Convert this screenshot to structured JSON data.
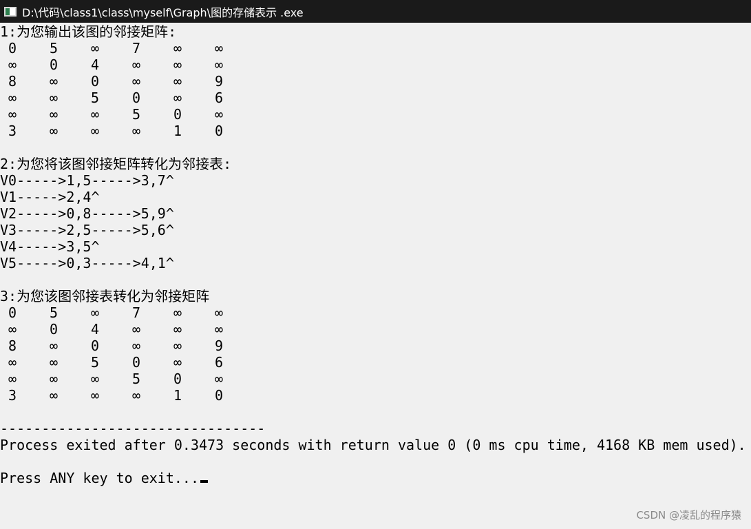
{
  "window": {
    "title": "D:\\代码\\class1\\class\\myself\\Graph\\图的存储表示 .exe"
  },
  "console": {
    "section1_header": "1:为您输出该图的邻接矩阵:",
    "matrix1": [
      [
        "0",
        "5",
        "∞",
        "7",
        "∞",
        "∞"
      ],
      [
        "∞",
        "0",
        "4",
        "∞",
        "∞",
        "∞"
      ],
      [
        "8",
        "∞",
        "0",
        "∞",
        "∞",
        "9"
      ],
      [
        "∞",
        "∞",
        "5",
        "0",
        "∞",
        "6"
      ],
      [
        "∞",
        "∞",
        "∞",
        "5",
        "0",
        "∞"
      ],
      [
        "3",
        "∞",
        "∞",
        "∞",
        "1",
        "0"
      ]
    ],
    "section2_header": "2:为您将该图邻接矩阵转化为邻接表:",
    "adjacency_list": [
      "V0----->1,5----->3,7^",
      "V1----->2,4^",
      "V2----->0,8----->5,9^",
      "V3----->2,5----->5,6^",
      "V4----->3,5^",
      "V5----->0,3----->4,1^"
    ],
    "section3_header": "3:为您该图邻接表转化为邻接矩阵",
    "matrix2": [
      [
        "0",
        "5",
        "∞",
        "7",
        "∞",
        "∞"
      ],
      [
        "∞",
        "0",
        "4",
        "∞",
        "∞",
        "∞"
      ],
      [
        "8",
        "∞",
        "0",
        "∞",
        "∞",
        "9"
      ],
      [
        "∞",
        "∞",
        "5",
        "0",
        "∞",
        "6"
      ],
      [
        "∞",
        "∞",
        "∞",
        "5",
        "0",
        "∞"
      ],
      [
        "3",
        "∞",
        "∞",
        "∞",
        "1",
        "0"
      ]
    ],
    "separator": "--------------------------------",
    "process_status": "Process exited after 0.3473 seconds with return value 0 (0 ms cpu time, 4168 KB mem used).",
    "exit_prompt": "Press ANY key to exit..."
  },
  "watermark": "CSDN @凌乱的程序猿"
}
